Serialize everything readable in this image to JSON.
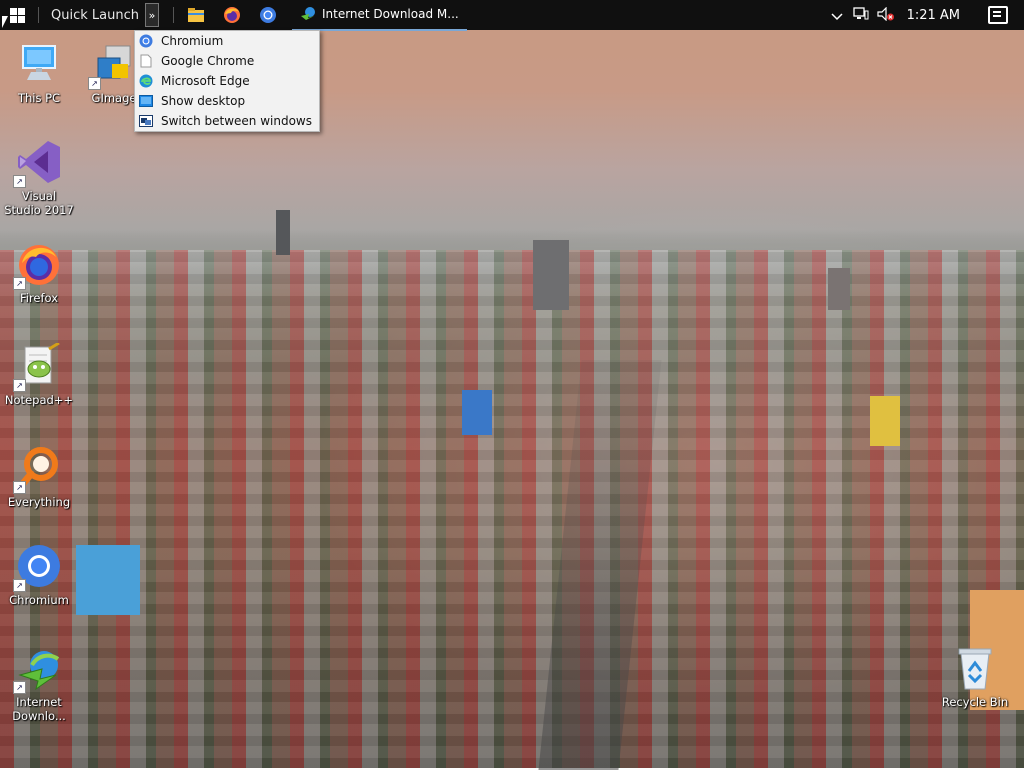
{
  "taskbar": {
    "quick_launch_label": "Quick Launch",
    "chevron_glyph": "»",
    "pinned": [
      {
        "name": "file-explorer-icon",
        "title": "File Explorer"
      },
      {
        "name": "firefox-icon",
        "title": "Firefox"
      },
      {
        "name": "chromium-icon",
        "title": "Chromium"
      }
    ],
    "active_app_title": "Internet Download M...",
    "clock": "1:21 AM"
  },
  "flyout": {
    "items": [
      {
        "label": "Chromium",
        "icon": "chromium-icon"
      },
      {
        "label": "Google Chrome",
        "icon": "blank-page-icon"
      },
      {
        "label": "Microsoft Edge",
        "icon": "edge-icon"
      },
      {
        "label": "Show desktop",
        "icon": "show-desktop-icon"
      },
      {
        "label": "Switch between windows",
        "icon": "switch-windows-icon"
      }
    ]
  },
  "desktop": {
    "icons": [
      {
        "label": "This PC",
        "icon": "computer-icon"
      },
      {
        "label": "GImage",
        "icon": "gimage-icon"
      },
      {
        "label": "Visual Studio 2017",
        "icon": "visual-studio-icon"
      },
      {
        "label": "Firefox",
        "icon": "firefox-icon"
      },
      {
        "label": "Notepad++",
        "icon": "notepadpp-icon"
      },
      {
        "label": "Everything",
        "icon": "everything-icon"
      },
      {
        "label": "Chromium",
        "icon": "chromium-icon"
      },
      {
        "label": "Internet Downlo...",
        "icon": "idm-icon"
      },
      {
        "label": "Recycle Bin",
        "icon": "recycle-bin-icon"
      }
    ]
  },
  "colors": {
    "taskbar_bg": "#101010",
    "accent": "#7aa7d6",
    "menu_bg": "#f2f2f2"
  }
}
